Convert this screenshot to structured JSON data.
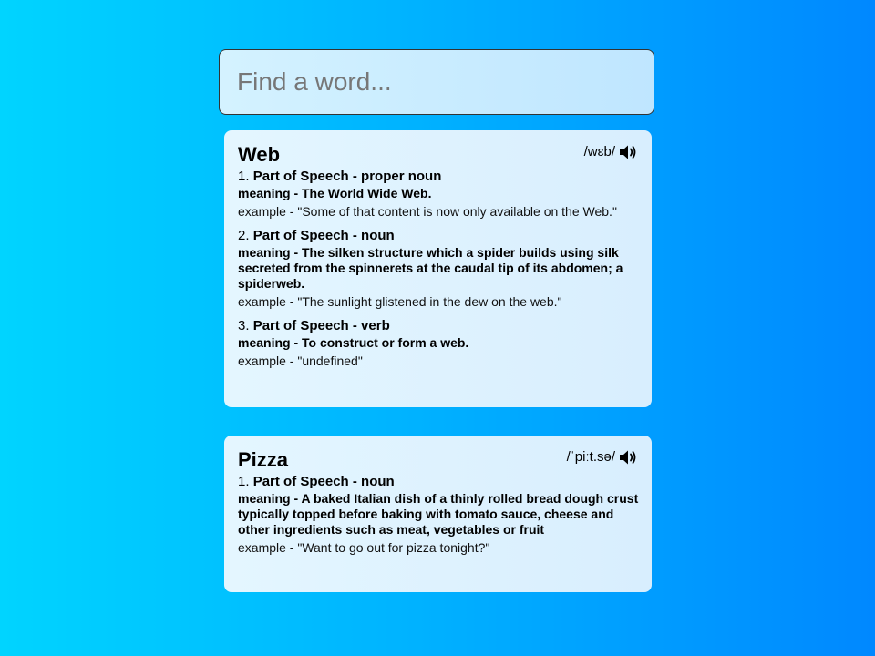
{
  "search": {
    "placeholder": "Find a word...",
    "value": ""
  },
  "results": [
    {
      "word": "Web",
      "phonetic": "/wɛb/",
      "sound_icon": "speaker-icon",
      "meanings": [
        {
          "number": "1.",
          "pos": "Part of Speech - proper noun",
          "definition": "meaning - The World Wide Web.",
          "example": "example - \"Some of that content is now only available on the Web.\""
        },
        {
          "number": "2.",
          "pos": "Part of Speech - noun",
          "definition": "meaning - The silken structure which a spider builds using silk secreted from the spinnerets at the caudal tip of its abdomen; a spiderweb.",
          "example": "example - \"The sunlight glistened in the dew on the web.\""
        },
        {
          "number": "3.",
          "pos": "Part of Speech - verb",
          "definition": "meaning - To construct or form a web.",
          "example": "example - \"undefined\""
        }
      ]
    },
    {
      "word": "Pizza",
      "phonetic": "/ˈpiːt.sə/",
      "sound_icon": "speaker-icon",
      "meanings": [
        {
          "number": "1.",
          "pos": "Part of Speech - noun",
          "definition": "meaning - A baked Italian dish of a thinly rolled bread dough crust typically topped before baking with tomato sauce, cheese and other ingredients such as meat, vegetables or fruit",
          "example": "example - \"Want to go out for pizza tonight?\""
        }
      ]
    }
  ],
  "colors": {
    "background_left": "#00d4ff",
    "background_right": "#0088ff",
    "card_background": "#e0f4ff",
    "search_background": "#c8ecff"
  }
}
